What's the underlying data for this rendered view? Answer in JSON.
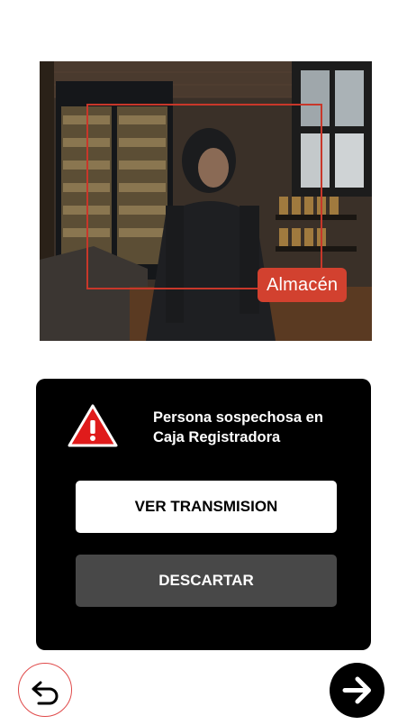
{
  "camera": {
    "zone_label": "Almacén"
  },
  "alert": {
    "icon": "warning-triangle-icon",
    "message_line1": "Persona sospechosa en",
    "message_line2": "Caja Registradora",
    "view_button": "VER TRANSMISION",
    "dismiss_button": "DESCARTAR",
    "colors": {
      "card_bg": "#000000",
      "warning_red": "#e01b1b",
      "zone_label_bg": "#d2412f",
      "dismiss_bg": "#484848"
    }
  },
  "nav": {
    "back_icon": "undo-arrow-icon",
    "next_icon": "arrow-right-icon"
  }
}
